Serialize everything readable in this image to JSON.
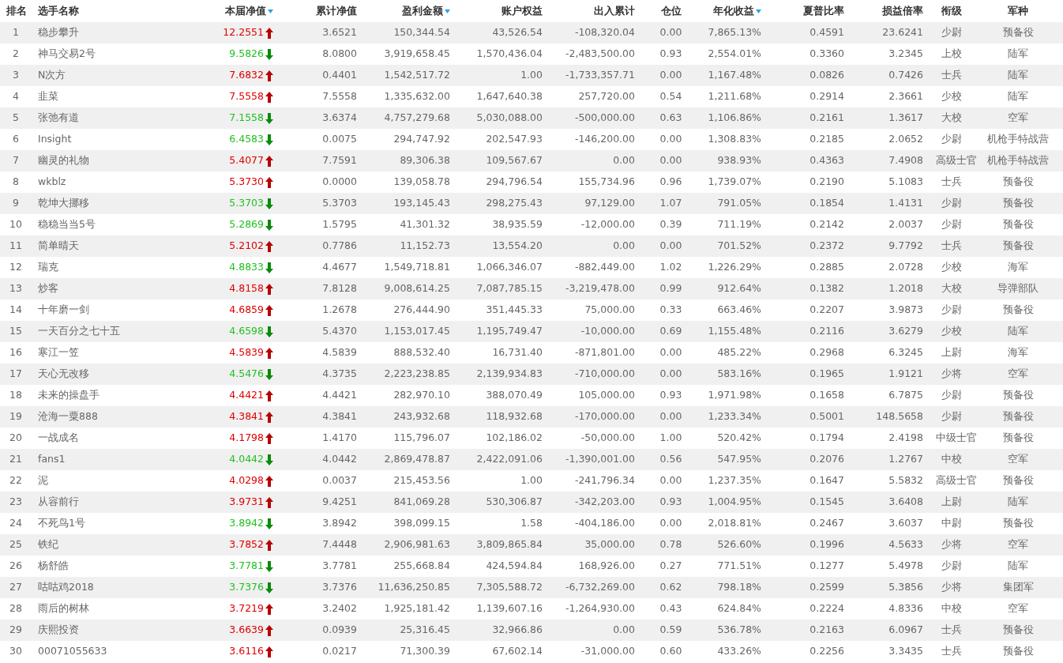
{
  "table": {
    "columns": [
      {
        "label": "排名",
        "sortable": false
      },
      {
        "label": "选手名称",
        "sortable": false
      },
      {
        "label": "本届净值",
        "sortable": true
      },
      {
        "label": "累计净值",
        "sortable": false
      },
      {
        "label": "盈利金额",
        "sortable": true
      },
      {
        "label": "账户权益",
        "sortable": false
      },
      {
        "label": "出入累计",
        "sortable": false
      },
      {
        "label": "仓位",
        "sortable": false
      },
      {
        "label": "年化收益",
        "sortable": true
      },
      {
        "label": "夏普比率",
        "sortable": false
      },
      {
        "label": "损益倍率",
        "sortable": false
      },
      {
        "label": "衔级",
        "sortable": false
      },
      {
        "label": "军种",
        "sortable": false
      }
    ],
    "rows": [
      {
        "kind": "up",
        "cells": [
          "1",
          "稳步攀升",
          "12.2551",
          "3.6521",
          "150,344.54",
          "43,526.54",
          "-108,320.04",
          "0.00",
          "7,865.13%",
          "0.4591",
          "23.6241",
          "少尉",
          "预备役"
        ]
      },
      {
        "kind": "down",
        "cells": [
          "2",
          "神马交易2号",
          "9.5826",
          "8.0800",
          "3,919,658.45",
          "1,570,436.04",
          "-2,483,500.00",
          "0.93",
          "2,554.01%",
          "0.3360",
          "3.2345",
          "上校",
          "陆军"
        ]
      },
      {
        "kind": "up",
        "cells": [
          "3",
          "N次方",
          "7.6832",
          "0.4401",
          "1,542,517.72",
          "1.00",
          "-1,733,357.71",
          "0.00",
          "1,167.48%",
          "0.0826",
          "0.7426",
          "士兵",
          "陆军"
        ]
      },
      {
        "kind": "up",
        "cells": [
          "4",
          "韭菜",
          "7.5558",
          "7.5558",
          "1,335,632.00",
          "1,647,640.38",
          "257,720.00",
          "0.54",
          "1,211.68%",
          "0.2914",
          "2.3661",
          "少校",
          "陆军"
        ]
      },
      {
        "kind": "down",
        "cells": [
          "5",
          "张弛有道",
          "7.1558",
          "3.6374",
          "4,757,279.68",
          "5,030,088.00",
          "-500,000.00",
          "0.63",
          "1,106.86%",
          "0.2161",
          "1.3617",
          "大校",
          "空军"
        ]
      },
      {
        "kind": "down",
        "cells": [
          "6",
          "Insight",
          "6.4583",
          "0.0075",
          "294,747.92",
          "202,547.93",
          "-146,200.00",
          "0.00",
          "1,308.83%",
          "0.2185",
          "2.0652",
          "少尉",
          "机枪手特战营"
        ]
      },
      {
        "kind": "up",
        "cells": [
          "7",
          "幽灵的礼物",
          "5.4077",
          "7.7591",
          "89,306.38",
          "109,567.67",
          "0.00",
          "0.00",
          "938.93%",
          "0.4363",
          "7.4908",
          "高级士官",
          "机枪手特战营"
        ]
      },
      {
        "kind": "up",
        "cells": [
          "8",
          "wkblz",
          "5.3730",
          "0.0000",
          "139,058.78",
          "294,796.54",
          "155,734.96",
          "0.96",
          "1,739.07%",
          "0.2190",
          "5.1083",
          "士兵",
          "预备役"
        ]
      },
      {
        "kind": "down",
        "cells": [
          "9",
          "乾坤大挪移",
          "5.3703",
          "5.3703",
          "193,145.43",
          "298,275.43",
          "97,129.00",
          "1.07",
          "791.05%",
          "0.1854",
          "1.4131",
          "少尉",
          "预备役"
        ]
      },
      {
        "kind": "down",
        "cells": [
          "10",
          "稳稳当当5号",
          "5.2869",
          "1.5795",
          "41,301.32",
          "38,935.59",
          "-12,000.00",
          "0.39",
          "711.19%",
          "0.2142",
          "2.0037",
          "少尉",
          "预备役"
        ]
      },
      {
        "kind": "up",
        "cells": [
          "11",
          "简单晴天",
          "5.2102",
          "0.7786",
          "11,152.73",
          "13,554.20",
          "0.00",
          "0.00",
          "701.52%",
          "0.2372",
          "9.7792",
          "士兵",
          "预备役"
        ]
      },
      {
        "kind": "down",
        "cells": [
          "12",
          "瑞克",
          "4.8833",
          "4.4677",
          "1,549,718.81",
          "1,066,346.07",
          "-882,449.00",
          "1.02",
          "1,226.29%",
          "0.2885",
          "2.0728",
          "少校",
          "海军"
        ]
      },
      {
        "kind": "up",
        "cells": [
          "13",
          "炒客",
          "4.8158",
          "7.8128",
          "9,008,614.25",
          "7,087,785.15",
          "-3,219,478.00",
          "0.99",
          "912.64%",
          "0.1382",
          "1.2018",
          "大校",
          "导弹部队"
        ]
      },
      {
        "kind": "up",
        "cells": [
          "14",
          "十年磨一剑",
          "4.6859",
          "1.2678",
          "276,444.90",
          "351,445.33",
          "75,000.00",
          "0.33",
          "663.46%",
          "0.2207",
          "3.9873",
          "少尉",
          "预备役"
        ]
      },
      {
        "kind": "down",
        "cells": [
          "15",
          "一天百分之七十五",
          "4.6598",
          "5.4370",
          "1,153,017.45",
          "1,195,749.47",
          "-10,000.00",
          "0.69",
          "1,155.48%",
          "0.2116",
          "3.6279",
          "少校",
          "陆军"
        ]
      },
      {
        "kind": "up",
        "cells": [
          "16",
          "寒江一笠",
          "4.5839",
          "4.5839",
          "888,532.40",
          "16,731.40",
          "-871,801.00",
          "0.00",
          "485.22%",
          "0.2968",
          "6.3245",
          "上尉",
          "海军"
        ]
      },
      {
        "kind": "down",
        "cells": [
          "17",
          "天心无改移",
          "4.5476",
          "4.3735",
          "2,223,238.85",
          "2,139,934.83",
          "-710,000.00",
          "0.00",
          "583.16%",
          "0.1965",
          "1.9121",
          "少将",
          "空军"
        ]
      },
      {
        "kind": "up",
        "cells": [
          "18",
          "未来的操盘手",
          "4.4421",
          "4.4421",
          "282,970.10",
          "388,070.49",
          "105,000.00",
          "0.93",
          "1,971.98%",
          "0.1658",
          "6.7875",
          "少尉",
          "预备役"
        ]
      },
      {
        "kind": "up",
        "cells": [
          "19",
          "沧海一粟888",
          "4.3841",
          "4.3841",
          "243,932.68",
          "118,932.68",
          "-170,000.00",
          "0.00",
          "1,233.34%",
          "0.5001",
          "148.5658",
          "少尉",
          "预备役"
        ]
      },
      {
        "kind": "up",
        "cells": [
          "20",
          "一战成名",
          "4.1798",
          "1.4170",
          "115,796.07",
          "102,186.02",
          "-50,000.00",
          "1.00",
          "520.42%",
          "0.1794",
          "2.4198",
          "中级士官",
          "预备役"
        ]
      },
      {
        "kind": "down",
        "cells": [
          "21",
          "fans1",
          "4.0442",
          "4.0442",
          "2,869,478.87",
          "2,422,091.06",
          "-1,390,001.00",
          "0.56",
          "547.95%",
          "0.2076",
          "1.2767",
          "中校",
          "空军"
        ]
      },
      {
        "kind": "up",
        "cells": [
          "22",
          "泥",
          "4.0298",
          "0.0037",
          "215,453.56",
          "1.00",
          "-241,796.34",
          "0.00",
          "1,237.35%",
          "0.1647",
          "5.5832",
          "高级士官",
          "预备役"
        ]
      },
      {
        "kind": "up",
        "cells": [
          "23",
          "从容前行",
          "3.9731",
          "9.4251",
          "841,069.28",
          "530,306.87",
          "-342,203.00",
          "0.93",
          "1,004.95%",
          "0.1545",
          "3.6408",
          "上尉",
          "陆军"
        ]
      },
      {
        "kind": "down",
        "cells": [
          "24",
          "不死鸟1号",
          "3.8942",
          "3.8942",
          "398,099.15",
          "1.58",
          "-404,186.00",
          "0.00",
          "2,018.81%",
          "0.2467",
          "3.6037",
          "中尉",
          "预备役"
        ]
      },
      {
        "kind": "up",
        "cells": [
          "25",
          "铁纪",
          "3.7852",
          "7.4448",
          "2,906,981.63",
          "3,809,865.84",
          "35,000.00",
          "0.78",
          "526.60%",
          "0.1996",
          "4.5633",
          "少将",
          "空军"
        ]
      },
      {
        "kind": "down",
        "cells": [
          "26",
          "杨舒皓",
          "3.7781",
          "3.7781",
          "255,668.84",
          "424,594.84",
          "168,926.00",
          "0.27",
          "771.51%",
          "0.1277",
          "5.4978",
          "少尉",
          "陆军"
        ]
      },
      {
        "kind": "down",
        "cells": [
          "27",
          "咕咕鸡2018",
          "3.7376",
          "3.7376",
          "11,636,250.85",
          "7,305,588.72",
          "-6,732,269.00",
          "0.62",
          "798.18%",
          "0.2599",
          "5.3856",
          "少将",
          "集团军"
        ]
      },
      {
        "kind": "up",
        "cells": [
          "28",
          "雨后的树林",
          "3.7219",
          "3.2402",
          "1,925,181.42",
          "1,139,607.16",
          "-1,264,930.00",
          "0.43",
          "624.84%",
          "0.2224",
          "4.8336",
          "中校",
          "空军"
        ]
      },
      {
        "kind": "up",
        "cells": [
          "29",
          "庆熙投资",
          "3.6639",
          "0.0939",
          "25,316.45",
          "32,966.86",
          "0.00",
          "0.59",
          "536.78%",
          "0.2163",
          "6.0967",
          "士兵",
          "预备役"
        ]
      },
      {
        "kind": "up",
        "cells": [
          "30",
          "00071055633",
          "3.6116",
          "0.0217",
          "71,300.39",
          "67,602.14",
          "-31,000.00",
          "0.60",
          "433.26%",
          "0.2256",
          "3.3435",
          "士兵",
          "预备役"
        ]
      }
    ]
  }
}
